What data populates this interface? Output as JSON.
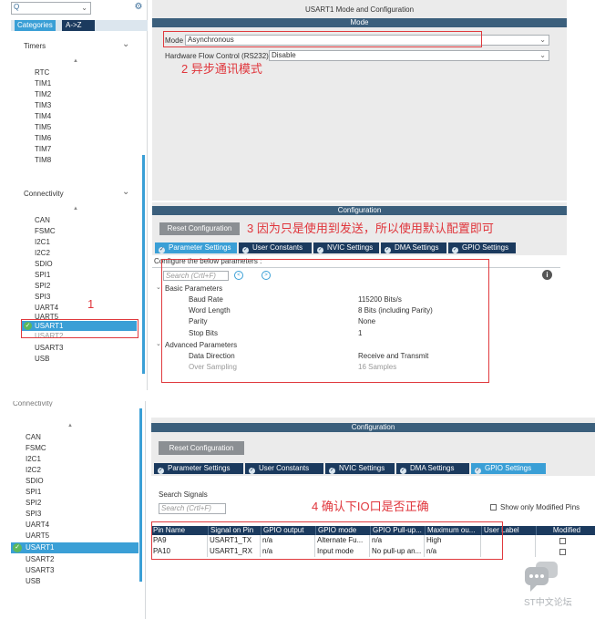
{
  "top": {
    "search_glyph": "Q",
    "tabs": {
      "categories": "Categories",
      "az": "A->Z"
    },
    "window_title": "USART1 Mode and Configuration",
    "mode_section": "Mode",
    "mode_label": "Mode",
    "mode_value": "Asynchronous",
    "hw_flow_label": "Hardware Flow Control (RS232)",
    "hw_flow_value": "Disable",
    "anno_mode": "2 异步通讯模式",
    "timers": {
      "header": "Timers",
      "items": [
        "RTC",
        "TIM1",
        "TIM2",
        "TIM3",
        "TIM4",
        "TIM5",
        "TIM6",
        "TIM7",
        "TIM8"
      ]
    },
    "connectivity": {
      "header": "Connectivity",
      "items": [
        "CAN",
        "FSMC",
        "I2C1",
        "I2C2",
        "SDIO",
        "SPI1",
        "SPI2",
        "SPI3",
        "UART4",
        "UART5",
        "USART1",
        "USART2",
        "USART3",
        "USB"
      ]
    },
    "anno_one": "1",
    "config_title": "Configuration",
    "reset_button": "Reset Configuration",
    "anno_reset": "3 因为只是使用到发送，所以使用默认配置即可",
    "tabs_config": [
      "Parameter Settings",
      "User Constants",
      "NVIC Settings",
      "DMA Settings",
      "GPIO Settings"
    ],
    "configure_hint": "Configure the below parameters :",
    "search_placeholder": "Search (Crtl+F)",
    "info_icon": "i",
    "basic_group": "Basic Parameters",
    "basic_params": [
      {
        "name": "Baud Rate",
        "value": "115200 Bits/s"
      },
      {
        "name": "Word Length",
        "value": "8 Bits (including Parity)"
      },
      {
        "name": "Parity",
        "value": "None"
      },
      {
        "name": "Stop Bits",
        "value": "1"
      }
    ],
    "advanced_group": "Advanced Parameters",
    "advanced_params": [
      {
        "name": "Data Direction",
        "value": "Receive and Transmit"
      },
      {
        "name": "Over Sampling",
        "value": "16 Samples"
      }
    ]
  },
  "bottom": {
    "cut_header": "Connectivity",
    "connectivity_items": [
      "CAN",
      "FSMC",
      "I2C1",
      "I2C2",
      "SDIO",
      "SPI1",
      "SPI2",
      "SPI3",
      "UART4",
      "UART5",
      "USART1",
      "USART2",
      "USART3",
      "USB"
    ],
    "config_title": "Configuration",
    "reset_button": "Reset Configuration",
    "tabs_config": [
      "Parameter Settings",
      "User Constants",
      "NVIC Settings",
      "DMA Settings",
      "GPIO Settings"
    ],
    "search_signals": "Search Signals",
    "search_placeholder": "Search (Crtl+F)",
    "anno_io": "4 确认下IO口是否正确",
    "show_modified": "Show only Modified Pins",
    "columns": [
      "Pin Name",
      "Signal on Pin",
      "GPIO output",
      "GPIO mode",
      "GPIO Pull-up...",
      "Maximum ou...",
      "User Label",
      "Modified"
    ],
    "rows": [
      [
        "PA9",
        "USART1_TX",
        "n/a",
        "Alternate Fu...",
        "n/a",
        "High",
        "",
        ""
      ],
      [
        "PA10",
        "USART1_RX",
        "n/a",
        "Input mode",
        "No pull-up an...",
        "n/a",
        "",
        ""
      ]
    ],
    "watermark": "ST中文论坛"
  },
  "colors": {
    "accent": "#3a9fd6",
    "dark_tab": "#1b3a5e",
    "annotation_red": "#e0363c",
    "selected_row": "#3a9fd6"
  }
}
